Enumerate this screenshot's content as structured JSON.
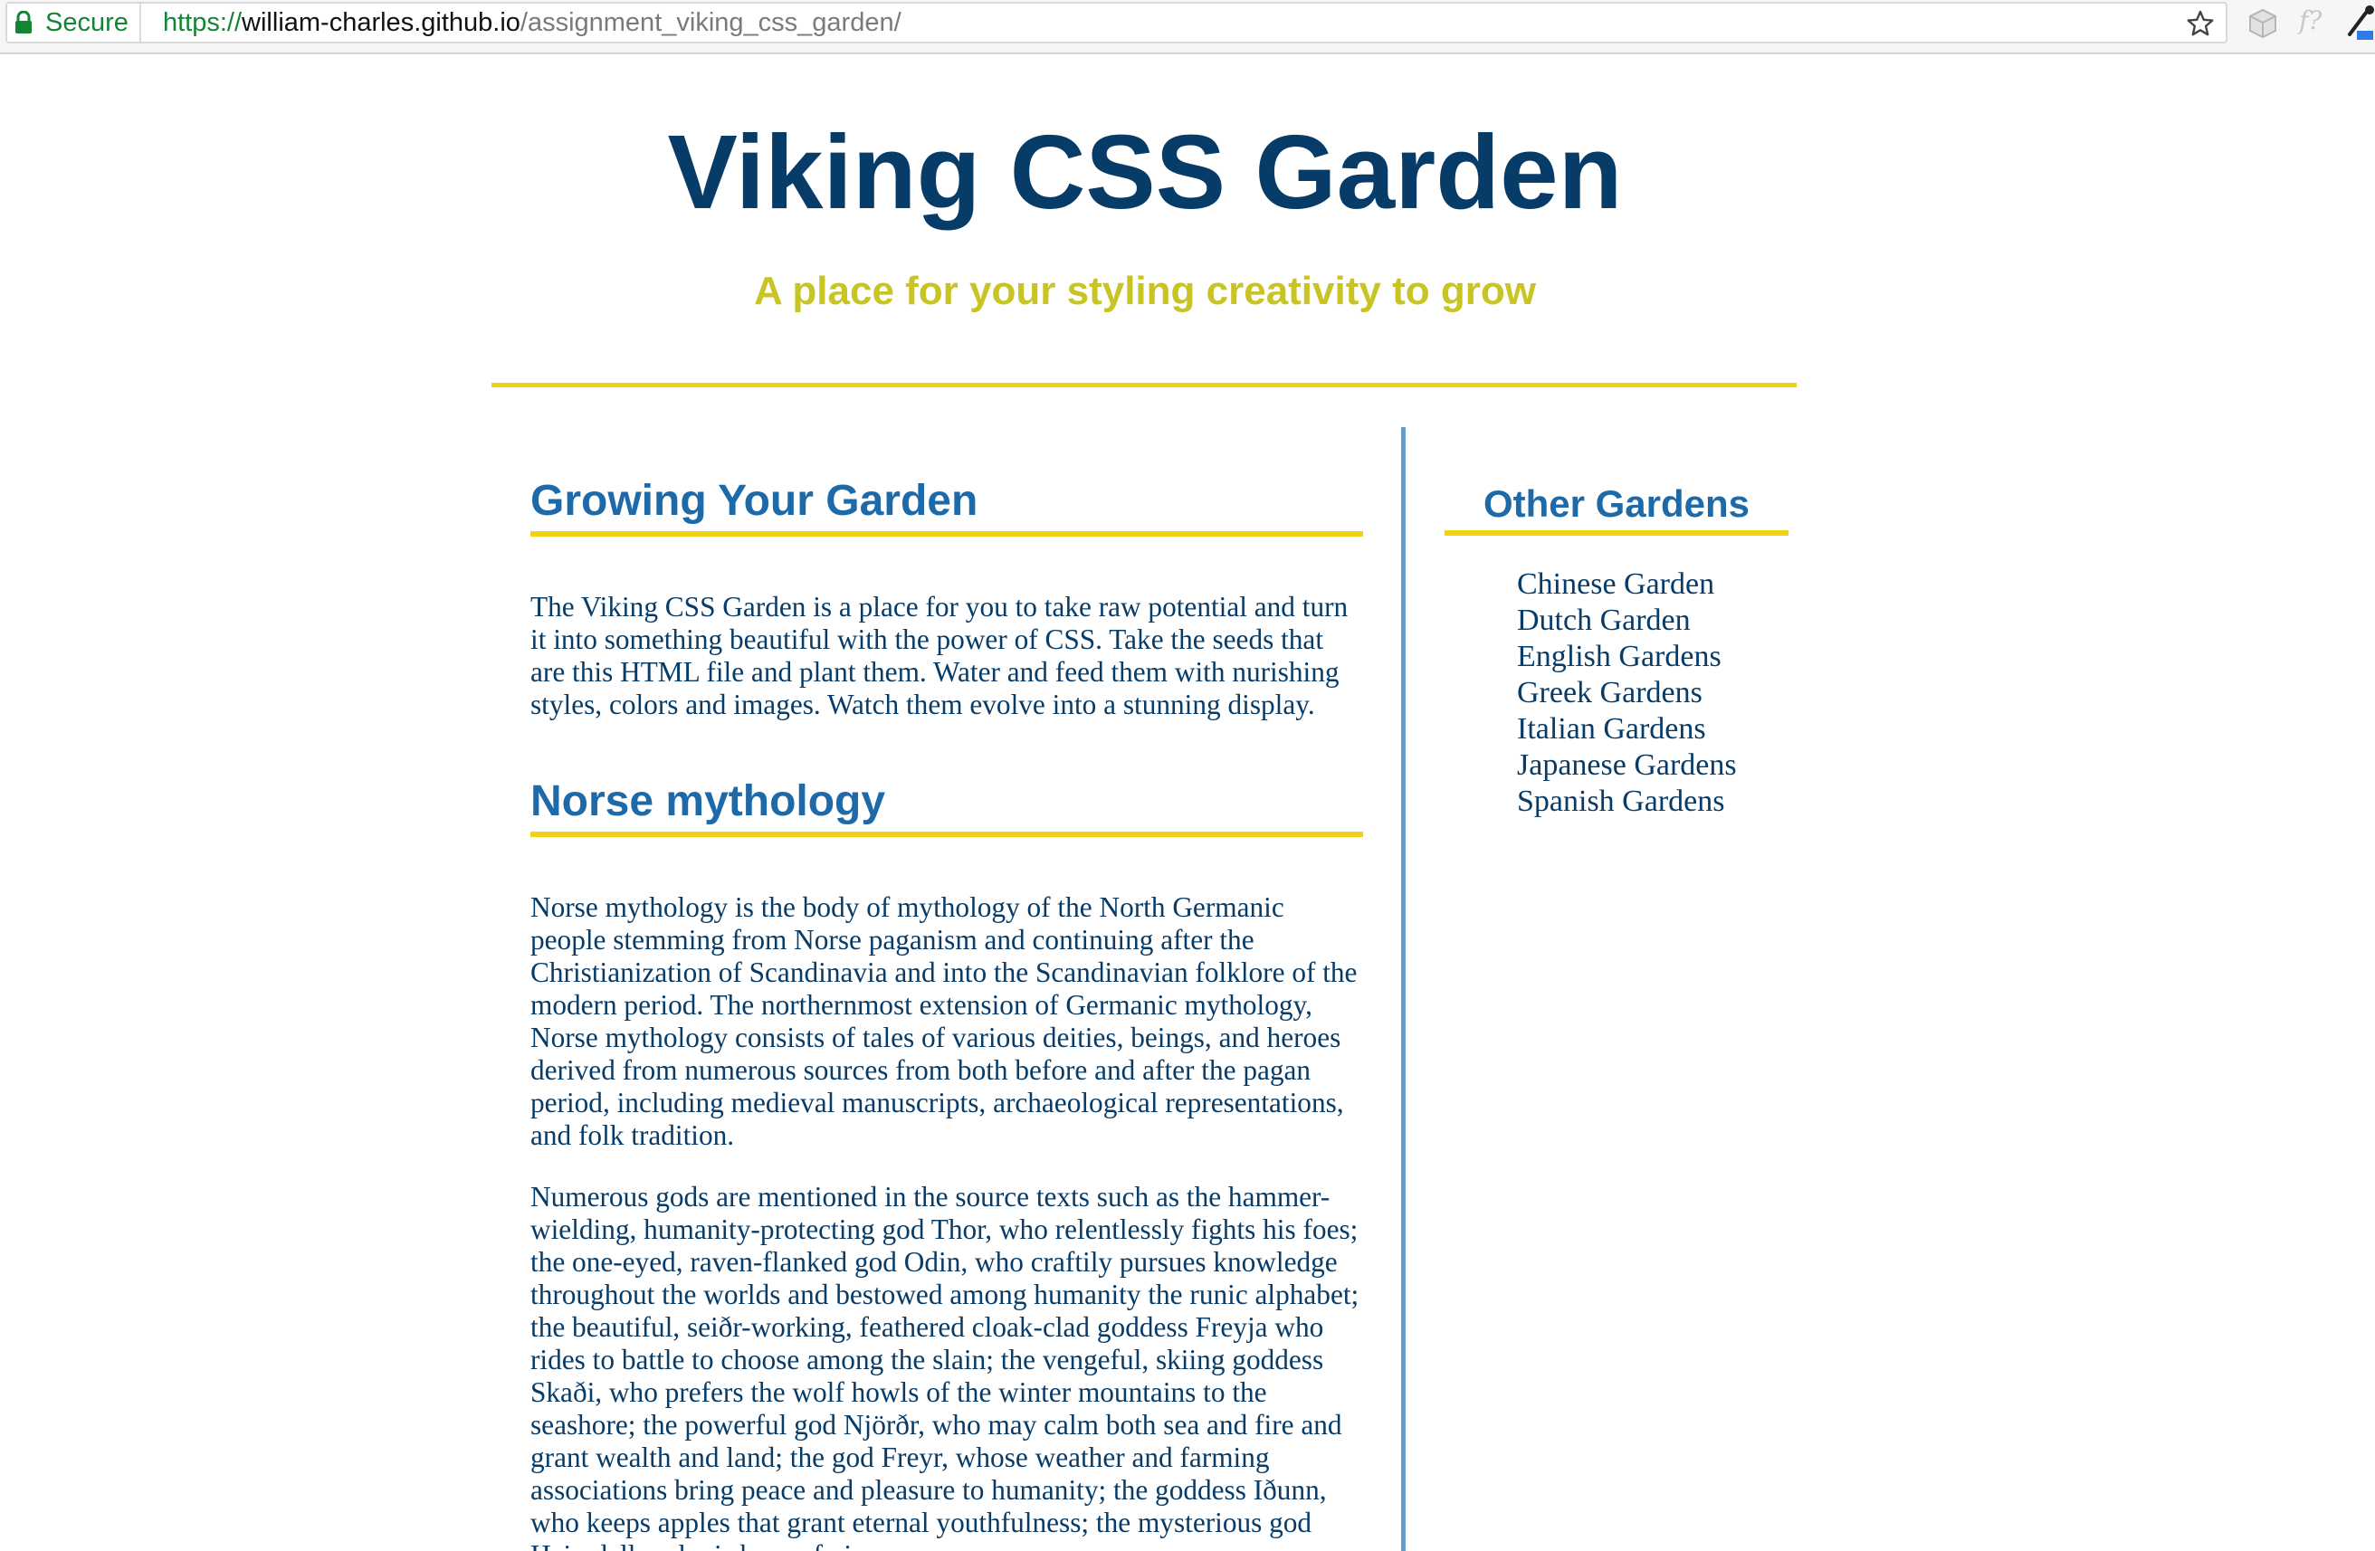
{
  "browser": {
    "secure_label": "Secure",
    "url": {
      "scheme": "https://",
      "host": "william-charles.github.io",
      "path": "/assignment_viking_css_garden/"
    },
    "ext_icon_2_glyph": "f?"
  },
  "header": {
    "title": "Viking CSS Garden",
    "tagline": "A place for your styling creativity to grow"
  },
  "main": {
    "sections": [
      {
        "heading": "Growing Your Garden",
        "paragraphs": [
          "The Viking CSS Garden is a place for you to take raw potential and turn it into something beautiful with the power of CSS. Take the seeds that are this HTML file and plant them. Water and feed them with nurishing styles, colors and images. Watch them evolve into a stunning display."
        ]
      },
      {
        "heading": "Norse mythology",
        "paragraphs": [
          "Norse mythology is the body of mythology of the North Germanic people stemming from Norse paganism and continuing after the Christianization of Scandinavia and into the Scandinavian folklore of the modern period. The northernmost extension of Germanic mythology, Norse mythology consists of tales of various deities, beings, and heroes derived from numerous sources from both before and after the pagan period, including medieval manuscripts, archaeological representations, and folk tradition.",
          "Numerous gods are mentioned in the source texts such as the hammer-wielding, humanity-protecting god Thor, who relentlessly fights his foes; the one-eyed, raven-flanked god Odin, who craftily pursues knowledge throughout the worlds and bestowed among humanity the runic alphabet; the beautiful, seiðr-working, feathered cloak-clad goddess Freyja who rides to battle to choose among the slain; the vengeful, skiing goddess Skaði, who prefers the wolf howls of the winter mountains to the seashore; the powerful god Njörðr, who may calm both sea and fire and grant wealth and land; the god Freyr, whose weather and farming associations bring peace and pleasure to humanity; the goddess Iðunn, who keeps apples that grant eternal youthfulness; the mysterious god Heimdallr, who is born of nine"
        ]
      }
    ]
  },
  "sidebar": {
    "heading": "Other Gardens",
    "items": [
      "Chinese Garden",
      "Dutch Garden",
      "English Gardens",
      "Greek Gardens",
      "Italian Gardens",
      "Japanese Gardens",
      "Spanish Gardens"
    ]
  },
  "colors": {
    "title": "#083c68",
    "tagline": "#c8c423",
    "heading": "#1e69a8",
    "body_text": "#083c68",
    "accent_rule": "#f0d215",
    "divider": "#6b9cc4",
    "secure_green": "#138636"
  }
}
